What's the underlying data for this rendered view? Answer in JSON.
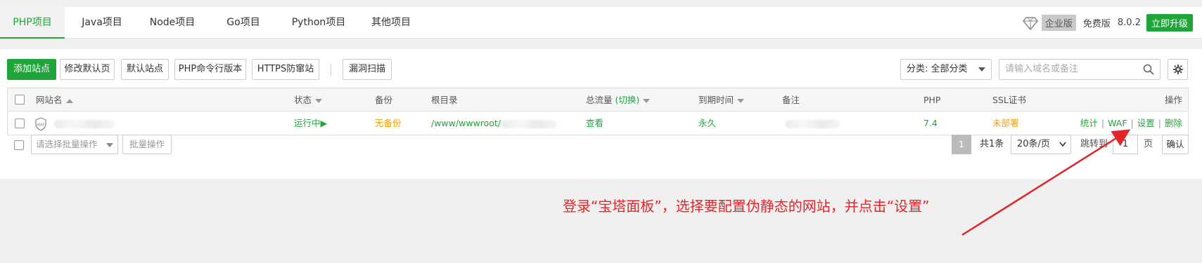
{
  "tabs": [
    "PHP项目",
    "Java项目",
    "Node项目",
    "Go项目",
    "Python项目",
    "其他项目"
  ],
  "header": {
    "enterprise": "企业版",
    "free": "免费版",
    "version": "8.0.2",
    "upgrade": "立即升级"
  },
  "toolbar": {
    "add_site": "添加站点",
    "edit_default_page": "修改默认页",
    "default_site": "默认站点",
    "php_cli": "PHP命令行版本",
    "https_guard": "HTTPS防窜站",
    "vuln_scan": "漏洞扫描",
    "category": "分类: 全部分类",
    "search_placeholder": "请输入域名或备注"
  },
  "table": {
    "headers": {
      "name": "网站名",
      "status": "状态",
      "backup": "备份",
      "root": "根目录",
      "traffic": "总流量",
      "traffic_switch": "(切换)",
      "expire": "到期时间",
      "remark": "备注",
      "php": "PHP",
      "ssl": "SSL证书",
      "ops": "操作"
    },
    "row": {
      "waf_badge": "WAF",
      "status": "运行中▶",
      "backup": "无备份",
      "root": "/www/wwwroot/",
      "traffic": "查看",
      "expire": "永久",
      "php": "7.4",
      "ssl": "未部署",
      "ops": [
        "统计",
        "WAF",
        "设置",
        "删除"
      ]
    }
  },
  "footer": {
    "batch_placeholder": "请选择批量操作",
    "batch_button": "批量操作",
    "current_page": "1",
    "total": "共1条",
    "per_page": "20条/页",
    "jump_to": "跳转到",
    "jump_value": "1",
    "page_unit": "页",
    "confirm": "确认"
  },
  "annotation": "登录“宝塔面板”，选择要配置伪静态的网站，并点击“设置”",
  "colors": {
    "accent": "#20a53a",
    "warning": "#f0a000",
    "annotation": "#e0262a"
  }
}
